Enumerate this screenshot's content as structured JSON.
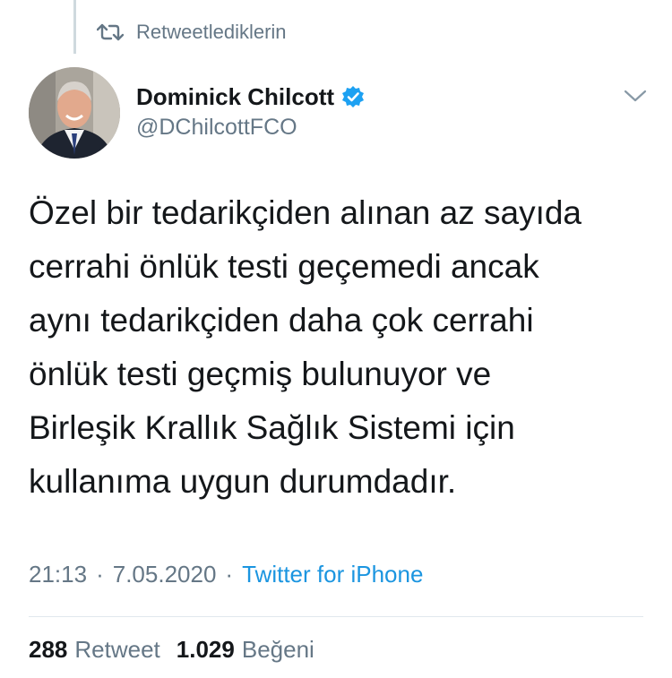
{
  "context": {
    "label": "Retweetlediklerin",
    "icon": "retweet-icon"
  },
  "author": {
    "name": "Dominick Chilcott",
    "handle": "@DChilcottFCO",
    "verified": true,
    "avatar_icon": "profile-photo"
  },
  "menu": {
    "icon": "chevron-down-icon"
  },
  "tweet": {
    "lines": [
      "Özel bir tedarikçiden alınan az sayıda",
      "cerrahi önlük testi geçemedi ancak",
      "aynı tedarikçiden daha çok cerrahi",
      "önlük testi geçmiş bulunuyor ve",
      "Birleşik Krallık Sağlık Sistemi için",
      "kullanıma uygun durumdadır."
    ],
    "time": "21:13",
    "date": "7.05.2020",
    "separator": "·",
    "source": "Twitter for iPhone"
  },
  "stats": {
    "retweets": {
      "count": "288",
      "label": "Retweet"
    },
    "likes": {
      "count": "1.029",
      "label": "Beğeni"
    }
  },
  "colors": {
    "text": "#14171a",
    "secondary": "#657786",
    "link": "#1b95e0",
    "verified": "#1da1f2"
  }
}
